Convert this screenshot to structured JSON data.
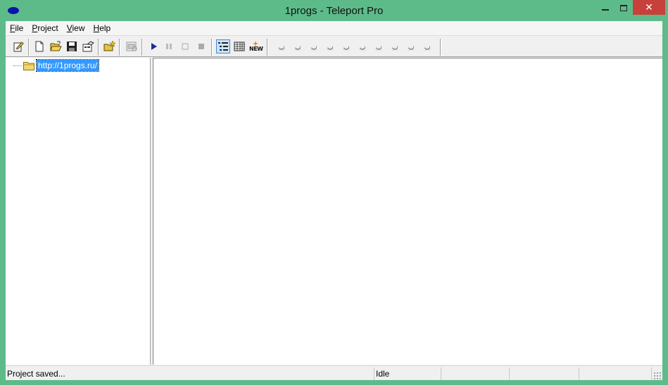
{
  "window": {
    "title": "1progs - Teleport Pro",
    "accent_color": "#5dbb8a",
    "close_color": "#c7413a",
    "icon": "app-icon",
    "controls": {
      "minimize": "minimize-icon",
      "maximize": "maximize-icon",
      "close": "close-icon",
      "close_glyph": "✕"
    }
  },
  "menu": {
    "items": [
      {
        "label": "File",
        "accel": "F"
      },
      {
        "label": "Project",
        "accel": "P"
      },
      {
        "label": "View",
        "accel": "V"
      },
      {
        "label": "Help",
        "accel": "H"
      }
    ]
  },
  "toolbar": {
    "buttons": [
      "new-project-wizard-icon",
      "new-document-icon",
      "open-folder-icon",
      "save-disk-icon",
      "project-properties-icon",
      "folder-star-icon",
      "browse-offline-icon",
      "start-icon",
      "pause-icon",
      "stop-icon",
      "stop-all-icon",
      "tree-view-icon",
      "list-view-icon",
      "new-files-icon"
    ],
    "new_icon_text": "NEW",
    "thread_indicators": 10,
    "thread_icon": "thread-idle-icon"
  },
  "tree": {
    "root": {
      "label": "http://1progs.ru/",
      "icon": "folder-icon",
      "selected": true
    }
  },
  "status": {
    "message": "Project saved...",
    "state": "Idle"
  }
}
